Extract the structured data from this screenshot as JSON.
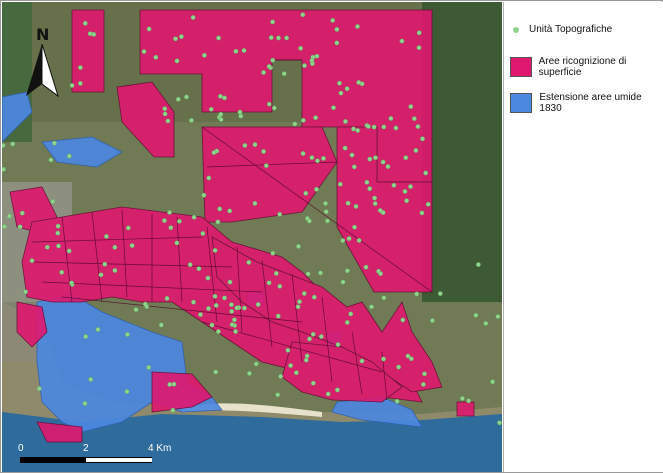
{
  "map": {
    "north_label": "N",
    "scale": {
      "ticks": [
        "0",
        "2",
        "4 Km"
      ],
      "max_km": 4
    },
    "colors": {
      "survey": "#e0176f",
      "wetland": "#4c88e0",
      "dot": "#8fd48c",
      "sea": "#2d6a9a"
    }
  },
  "legend": {
    "items": [
      {
        "label": "Unità Topografiche",
        "symbol": "dot",
        "color": "#8fd48c"
      },
      {
        "label": "Aree ricognizione di superficie",
        "symbol": "polygon",
        "color": "#e0176f"
      },
      {
        "label": "Estensione aree umide 1830",
        "symbol": "polygon",
        "color": "#4c88e0"
      }
    ]
  }
}
